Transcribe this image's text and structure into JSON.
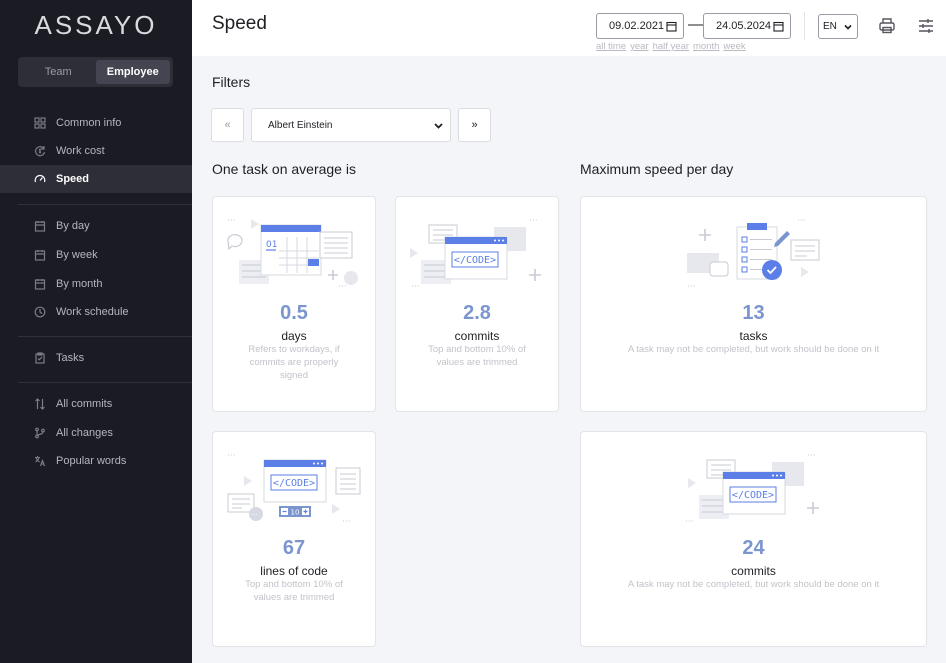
{
  "sidebar": {
    "logo": "ASSAYO",
    "toggle": [
      "Team",
      "Employee"
    ],
    "groups": [
      [
        {
          "label": "Common info",
          "icon": "grid-icon"
        },
        {
          "label": "Work cost",
          "icon": "refresh-cost-icon"
        },
        {
          "label": "Speed",
          "icon": "speedometer-icon",
          "active": true
        }
      ],
      [
        {
          "label": "By day",
          "icon": "calendar-day-icon"
        },
        {
          "label": "By week",
          "icon": "calendar-week-icon"
        },
        {
          "label": "By month",
          "icon": "calendar-month-icon"
        },
        {
          "label": "Work schedule",
          "icon": "clock-icon"
        }
      ],
      [
        {
          "label": "Tasks",
          "icon": "clipboard-icon"
        }
      ],
      [
        {
          "label": "All commits",
          "icon": "sort-commits-icon"
        },
        {
          "label": "All changes",
          "icon": "branch-icon"
        },
        {
          "label": "Popular words",
          "icon": "translate-icon"
        }
      ]
    ]
  },
  "header": {
    "title": "Speed",
    "date_from": "09.02.2021",
    "date_to": "24.05.2024",
    "dash": "—",
    "quick_ranges": [
      "all time",
      "year",
      "half year",
      "month",
      "week"
    ],
    "language": "EN"
  },
  "filters": {
    "title": "Filters",
    "prev": "«",
    "next": "»",
    "employee": "Albert Einstein"
  },
  "sections": {
    "average": "One task on average is",
    "max": "Maximum speed per day"
  },
  "cards": {
    "avg_days": {
      "value": "0.5",
      "unit": "days",
      "note": "Refers to workdays, if commits are properly signed"
    },
    "avg_commits": {
      "value": "2.8",
      "unit": "commits",
      "note": "Top and bottom 10% of values are trimmed"
    },
    "max_tasks": {
      "value": "13",
      "unit": "tasks",
      "note": "A task may not be completed, but work should be done on it"
    },
    "avg_lines": {
      "value": "67",
      "unit": "lines of code",
      "note": "Top and bottom 10% of values are trimmed",
      "counter": "10"
    },
    "max_commits": {
      "value": "24",
      "unit": "commits",
      "note": "A task may not be completed, but work should be done on it"
    }
  },
  "illustration_text": {
    "code": "</CODE>",
    "calendar_day": "01"
  },
  "colors": {
    "sidebar_bg": "#1b1c23",
    "accent": "#7b95cf",
    "illus_blue": "#5b7fe6",
    "active_bg": "#2d2e37"
  }
}
